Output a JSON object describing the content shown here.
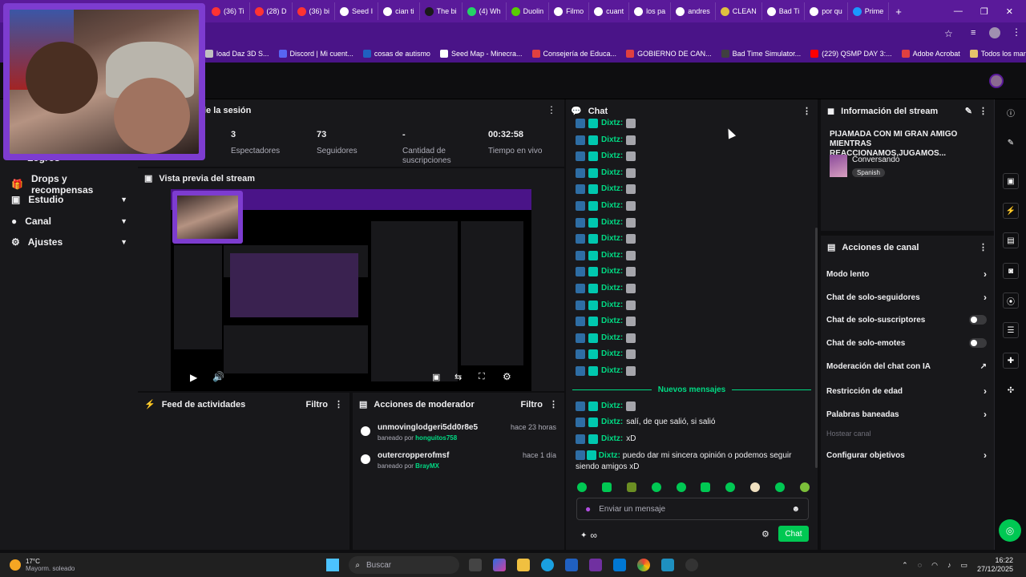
{
  "browser": {
    "tabs": [
      "(36) Ti",
      "(28) D",
      "(36) bi",
      "Seed I",
      "cian ti",
      "The bi",
      "(4) Wh",
      "Duolin",
      "Filmo",
      "cuant",
      "los pa",
      "andres",
      "CLEAN",
      "Bad Ti",
      "por qu",
      "Prime"
    ],
    "new_tab": "+",
    "bookmarks": [
      "load Daz 3D S...",
      "Discord | Mi cuent...",
      "cosas de autismo",
      "Seed Map - Minecra...",
      "Consejería de Educa...",
      "GOBIERNO DE CAN...",
      "Bad Time Simulator...",
      "(229) QSMP DAY 3:...",
      "Adobe Acrobat"
    ],
    "all_bookmarks": "Todos los marcadores"
  },
  "sidebar": {
    "partial_label": "Logros",
    "items": [
      {
        "label": "Drops y recompensas",
        "icon": "gift-icon"
      },
      {
        "label": "Estudio",
        "icon": "camera-icon"
      },
      {
        "label": "Canal",
        "icon": "person-icon"
      },
      {
        "label": "Ajustes",
        "icon": "gear-icon"
      }
    ]
  },
  "session": {
    "title": "le la sesión",
    "stats": [
      {
        "value": "3",
        "label": "Espectadores"
      },
      {
        "value": "73",
        "label": "Seguidores"
      },
      {
        "value": "-",
        "label": "Cantidad de suscripciones"
      },
      {
        "value": "00:32:58",
        "label": "Tiempo en vivo"
      }
    ]
  },
  "preview": {
    "title": "Vista previa del stream"
  },
  "feed": {
    "title": "Feed de actividades",
    "filter": "Filtro"
  },
  "mod_actions": {
    "title": "Acciones de moderador",
    "filter": "Filtro",
    "entries": [
      {
        "user": "unmovinglodgeri5dd0r8e5",
        "time": "hace 23 horas",
        "prefix": "baneado por",
        "by": "honguitos758"
      },
      {
        "user": "outercropperofmsf",
        "time": "hace 1 día",
        "prefix": "baneado por",
        "by": "BrayMX"
      }
    ]
  },
  "chat": {
    "title": "Chat",
    "username": "Dixtz:",
    "new_messages": "Nuevos mensajes",
    "messages": [
      "salí, de que salió, si salió",
      "xD",
      "puedo dar mi sincera opinión o podemos seguir siendo amigos xD"
    ],
    "input_placeholder": "Enviar un mensaje",
    "send_label": "Chat",
    "infinity": "∞"
  },
  "stream_info": {
    "title": "Información del stream",
    "stream_title": "PIJAMADA CON MI GRAN AMIGO MIENTRAS REACCIONAMOS,JUGAMOS...",
    "category": "Conversando",
    "language": "Spanish"
  },
  "channel_actions": {
    "title": "Acciones de canal",
    "items": [
      {
        "label": "Modo lento",
        "control": "chevron"
      },
      {
        "label": "Chat de solo-seguidores",
        "control": "chevron"
      },
      {
        "label": "Chat de solo-suscriptores",
        "control": "toggle"
      },
      {
        "label": "Chat de solo-emotes",
        "control": "toggle"
      },
      {
        "label": "Moderación del chat con IA",
        "control": "external"
      },
      {
        "label": "Restricción de edad",
        "control": "chevron"
      },
      {
        "label": "Palabras baneadas",
        "control": "chevron"
      },
      {
        "label": "Hostear canal",
        "control": "none",
        "disabled": true
      },
      {
        "label": "Configurar objetivos",
        "control": "chevron"
      }
    ]
  },
  "taskbar": {
    "weather_temp": "17°C",
    "weather_desc": "Mayorm. soleado",
    "search": "Buscar",
    "time": "16:22",
    "date": "27/12/2025"
  },
  "colors": {
    "accent": "#00db84",
    "brand": "#5a1a9a",
    "send_button": "#00c853"
  }
}
